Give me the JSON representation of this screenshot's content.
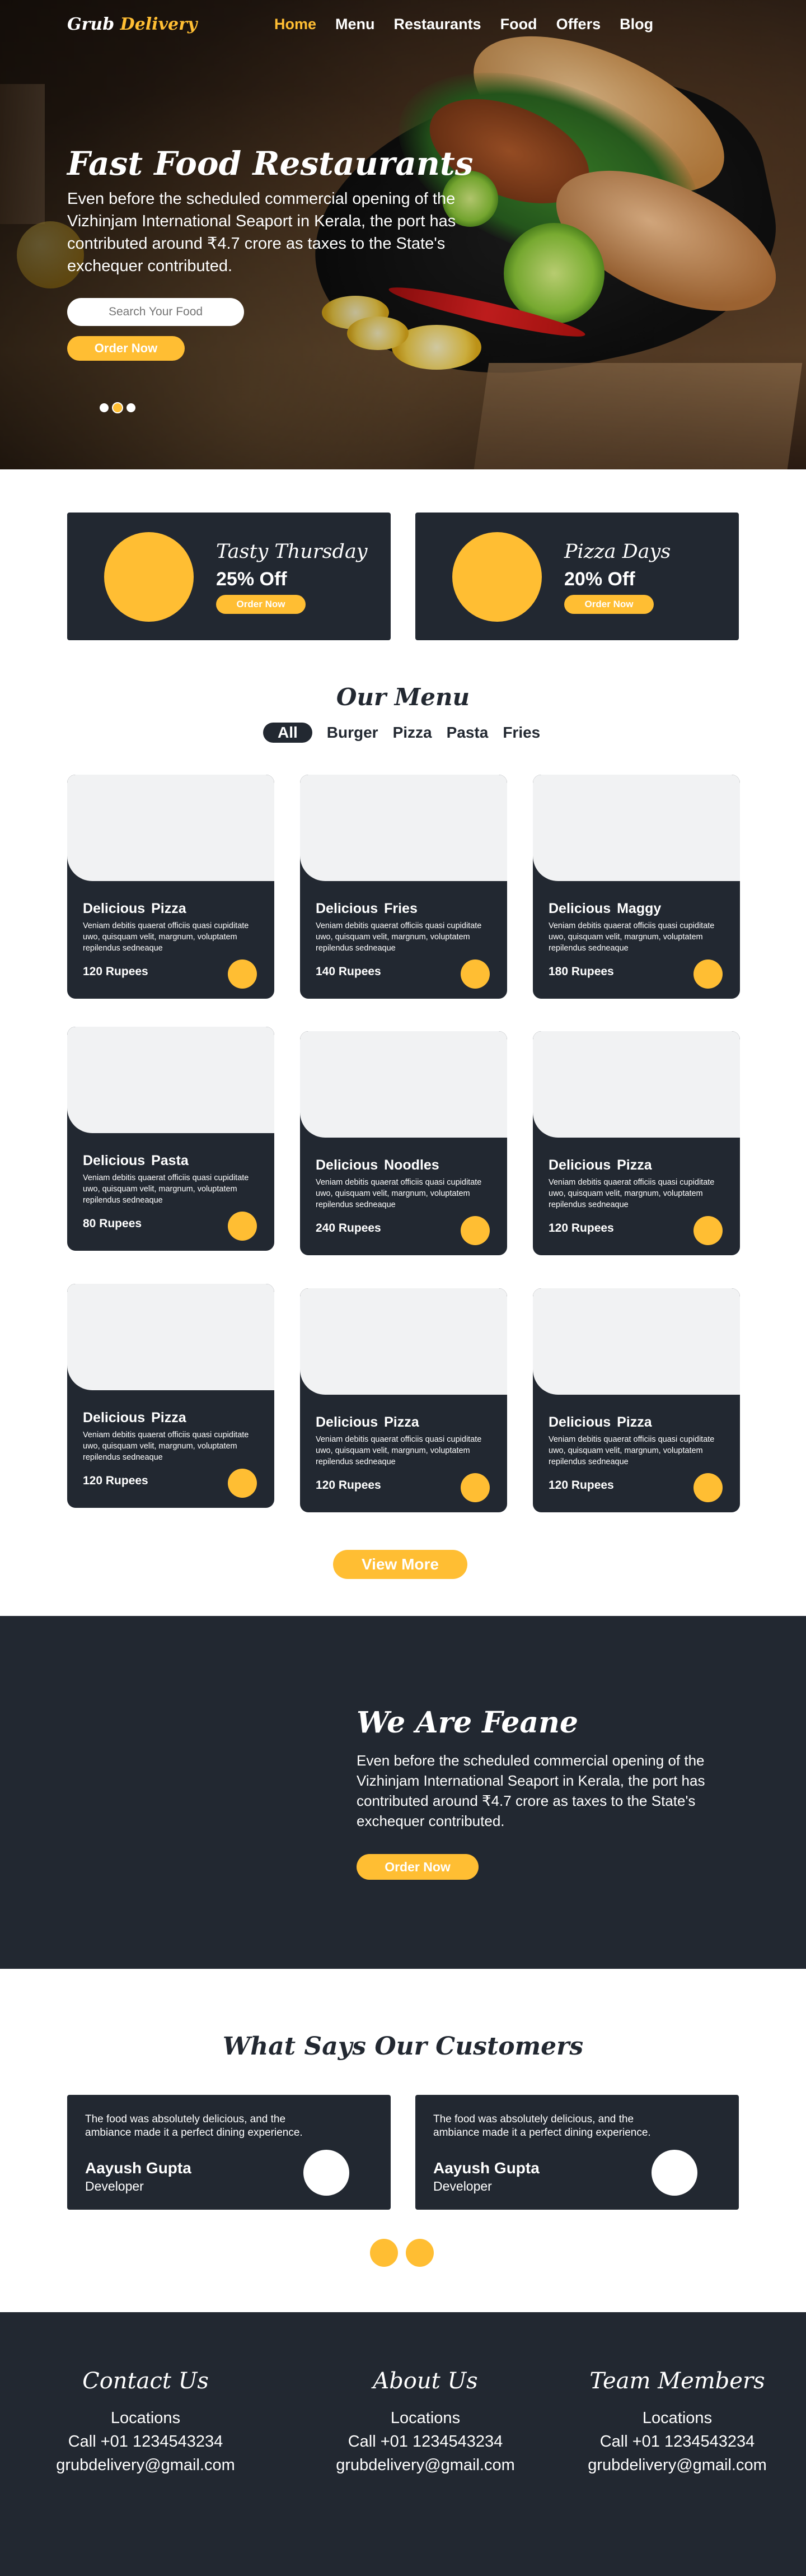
{
  "brand": {
    "name_part1": "Grub",
    "name_part2": "Delivery",
    "accent_color": "#ffbe33",
    "dark_color": "#222831"
  },
  "nav": {
    "items": [
      "Home",
      "Menu",
      "Restaurants",
      "Food",
      "Offers",
      "Blog"
    ],
    "active": "Home"
  },
  "hero": {
    "title": "Fast Food Restaurants",
    "text": "Even before the scheduled commercial opening of the Vizhinjam International Seaport in Kerala, the port has contributed around ₹4.7 crore as taxes to the State's exchequer contributed.",
    "search_placeholder": "Search Your Food",
    "order_button": "Order Now",
    "slides_count": 3,
    "active_slide": 2
  },
  "offers": [
    {
      "title": "Tasty Thursday",
      "discount": "25% Off",
      "button": "Order Now"
    },
    {
      "title": "Pizza Days",
      "discount": "20% Off",
      "button": "Order Now"
    }
  ],
  "menu": {
    "title": "Our Menu",
    "filters": [
      "All",
      "Burger",
      "Pizza",
      "Pasta",
      "Fries"
    ],
    "active_filter": "All",
    "items": [
      {
        "name": "Delicious  Pizza",
        "desc": "Veniam debitis quaerat officiis quasi cupiditate uwo, quisquam velit, margnum, voluptatem repilendus sedneaque",
        "price": "120 Rupees"
      },
      {
        "name": "Delicious  Fries",
        "desc": "Veniam debitis quaerat officiis quasi cupiditate uwo, quisquam velit, margnum, voluptatem repilendus sedneaque",
        "price": "140 Rupees"
      },
      {
        "name": "Delicious  Maggy",
        "desc": "Veniam debitis quaerat officiis quasi cupiditate uwo, quisquam velit, margnum, voluptatem repilendus sedneaque",
        "price": "180 Rupees"
      },
      {
        "name": "Delicious  Pasta",
        "desc": "Veniam debitis quaerat officiis quasi cupiditate uwo, quisquam velit, margnum, voluptatem repilendus sedneaque",
        "price": "80 Rupees"
      },
      {
        "name": "Delicious  Noodles",
        "desc": "Veniam debitis quaerat officiis quasi cupiditate uwo, quisquam velit, margnum, voluptatem repilendus sedneaque",
        "price": "240 Rupees"
      },
      {
        "name": "Delicious  Pizza",
        "desc": "Veniam debitis quaerat officiis quasi cupiditate uwo, quisquam velit, margnum, voluptatem repilendus sedneaque",
        "price": "120 Rupees"
      },
      {
        "name": "Delicious  Pizza",
        "desc": "Veniam debitis quaerat officiis quasi cupiditate uwo, quisquam velit, margnum, voluptatem repilendus sedneaque",
        "price": "120 Rupees"
      },
      {
        "name": "Delicious  Pizza",
        "desc": "Veniam debitis quaerat officiis quasi cupiditate uwo, quisquam velit, margnum, voluptatem repilendus sedneaque",
        "price": "120 Rupees"
      },
      {
        "name": "Delicious  Pizza",
        "desc": "Veniam debitis quaerat officiis quasi cupiditate uwo, quisquam velit, margnum, voluptatem repilendus sedneaque",
        "price": "120 Rupees"
      }
    ],
    "view_more": "View More"
  },
  "about": {
    "title": "We Are Feane",
    "text": "Even before the scheduled commercial opening of the Vizhinjam International Seaport in Kerala, the port has contributed around ₹4.7 crore as taxes to the State's exchequer contributed.",
    "button": "Order Now"
  },
  "testimonials": {
    "title": "What Says Our Customers",
    "items": [
      {
        "text": "The food was absolutely delicious, and the ambiance made it a perfect dining experience.",
        "name": "Aayush Gupta",
        "role": "Developer"
      },
      {
        "text": "The food was absolutely delicious, and the ambiance made it a perfect dining experience.",
        "name": "Aayush Gupta",
        "role": "Developer"
      }
    ]
  },
  "footer": {
    "columns": [
      {
        "heading": "Contact Us",
        "lines": [
          "Locations",
          "Call +01 1234543234",
          "grubdelivery@gmail.com"
        ]
      },
      {
        "heading": "About Us",
        "lines": [
          "Locations",
          "Call +01 1234543234",
          "grubdelivery@gmail.com"
        ]
      },
      {
        "heading": "Team Members",
        "lines": [
          "Locations",
          "Call +01 1234543234",
          "grubdelivery@gmail.com"
        ]
      }
    ]
  }
}
